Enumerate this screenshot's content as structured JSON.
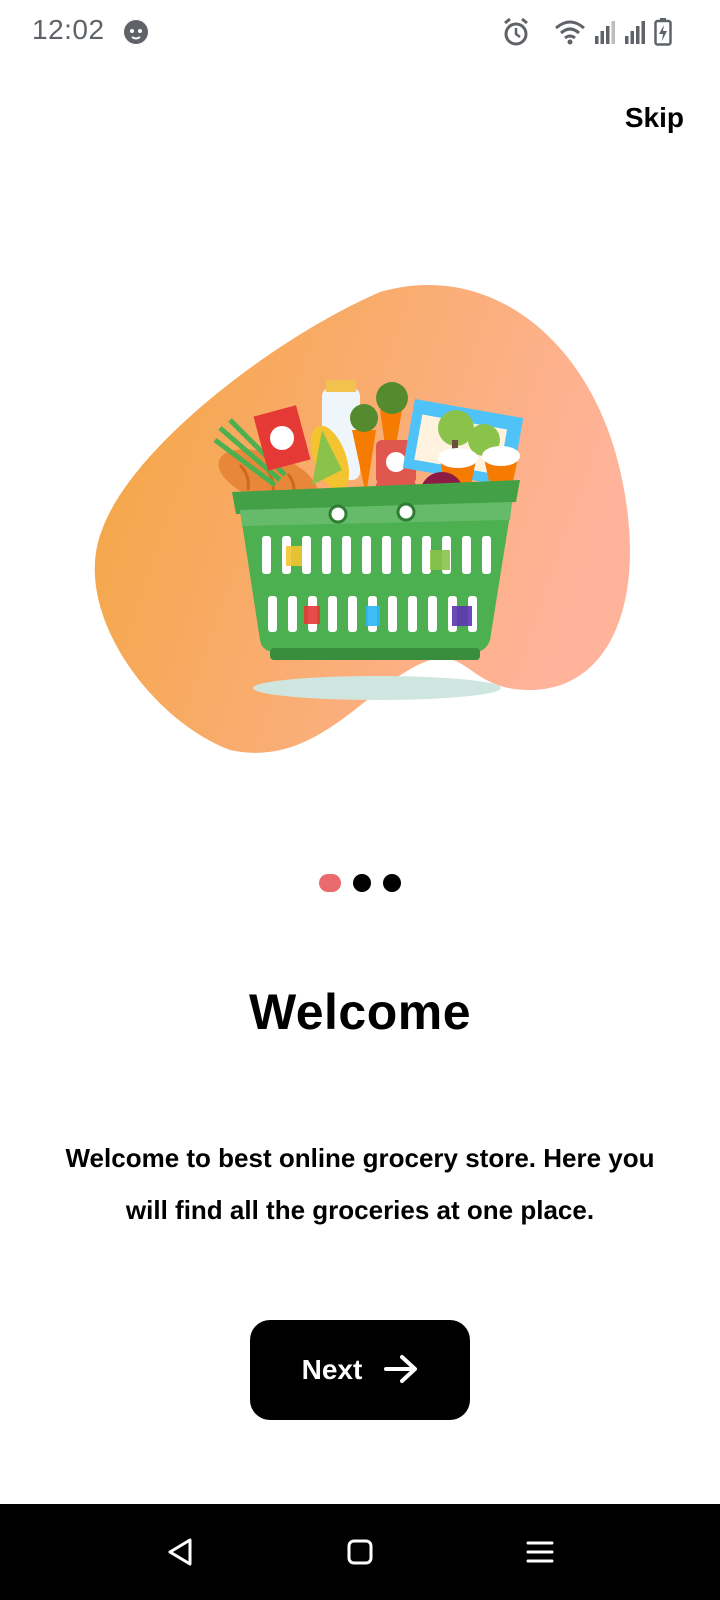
{
  "status_bar": {
    "time": "12:02",
    "icons": [
      "cat-face-icon",
      "alarm-icon",
      "wifi-icon",
      "signal-icon",
      "signal-icon",
      "battery-charging-icon"
    ]
  },
  "header": {
    "skip_label": "Skip"
  },
  "onboarding": {
    "illustration": "grocery-basket-illustration",
    "page_indicator": {
      "total": 3,
      "active_index": 0,
      "active_color": "#ea6a6e",
      "inactive_color": "#000000"
    },
    "title": "Welcome",
    "description": "Welcome to best online grocery store. Here you will find all the groceries at one place.",
    "next_label": "Next",
    "next_icon": "arrow-right-icon"
  },
  "colors": {
    "blob_start": "#f3a53f",
    "blob_end": "#ffb39a",
    "basket": "#4caf50",
    "button_bg": "#000000"
  },
  "nav_bar": {
    "buttons": [
      "back-icon",
      "home-icon",
      "menu-icon"
    ]
  }
}
